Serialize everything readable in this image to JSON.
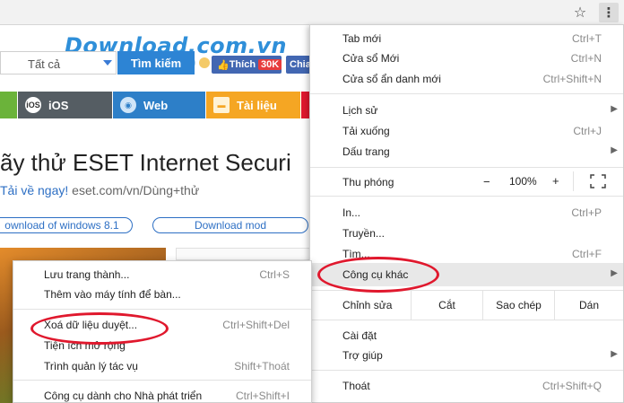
{
  "colors": {
    "accent_red": "#e0182d",
    "nav_green": "#6bb33a",
    "nav_ios": "#555d63",
    "nav_web": "#2d7fc8",
    "nav_docs": "#f5a623",
    "nav_red": "#e0182d"
  },
  "website": {
    "logo": "Download.com.vn",
    "search": {
      "category": "Tất cả",
      "button": "Tìm kiếm"
    },
    "like": {
      "label": "Thích",
      "count": "30K"
    },
    "share_label": "Chia",
    "nav": [
      {
        "label": "",
        "icon": "apple-icon"
      },
      {
        "label": "iOS",
        "icon": "ios-icon"
      },
      {
        "label": "Web",
        "icon": "globe-icon"
      },
      {
        "label": "Tài liệu",
        "icon": "folder-icon"
      }
    ],
    "ad_headline": "ãy thử ESET Internet Securi",
    "ad_subline": {
      "cta": "Tải về ngay!",
      "url": "eset.com/vn/Dùng+thử"
    },
    "pill_1": "ownload of windows 8.1",
    "pill_2": "Download mod"
  },
  "chrome_menu": {
    "group1": [
      {
        "label": "Tab mới",
        "shortcut": "Ctrl+T"
      },
      {
        "label": "Cửa sổ Mới",
        "shortcut": "Ctrl+N"
      },
      {
        "label": "Cửa sổ ẩn danh mới",
        "shortcut": "Ctrl+Shift+N"
      }
    ],
    "group2": [
      {
        "label": "Lịch sử",
        "shortcut": ""
      },
      {
        "label": "Tải xuống",
        "shortcut": "Ctrl+J"
      },
      {
        "label": "Dấu trang",
        "shortcut": ""
      }
    ],
    "zoom": {
      "label": "Thu phóng",
      "minus": "−",
      "value": "100%",
      "plus": "+"
    },
    "group3": [
      {
        "label": "In...",
        "shortcut": "Ctrl+P"
      },
      {
        "label": "Truyền...",
        "shortcut": ""
      },
      {
        "label": "Tìm...",
        "shortcut": "Ctrl+F"
      },
      {
        "label": "Công cụ khác",
        "shortcut": ""
      }
    ],
    "edit": {
      "label": "Chỉnh sửa",
      "cut": "Cắt",
      "copy": "Sao chép",
      "paste": "Dán"
    },
    "group4": [
      {
        "label": "Cài đặt",
        "shortcut": ""
      },
      {
        "label": "Trợ giúp",
        "shortcut": ""
      }
    ],
    "exit": {
      "label": "Thoát",
      "shortcut": "Ctrl+Shift+Q"
    }
  },
  "more_tools_menu": {
    "items": [
      {
        "label": "Lưu trang thành...",
        "shortcut": "Ctrl+S"
      },
      {
        "label": "Thêm vào máy tính để bàn...",
        "shortcut": ""
      },
      {
        "label": "Xoá dữ liệu duyệt...",
        "shortcut": "Ctrl+Shift+Del"
      },
      {
        "label": "Tiện ích mở rộng",
        "shortcut": ""
      },
      {
        "label": "Trình quản lý tác vụ",
        "shortcut": "Shift+Thoát"
      },
      {
        "label": "Công cụ dành cho Nhà phát triển",
        "shortcut": "Ctrl+Shift+I"
      }
    ]
  }
}
